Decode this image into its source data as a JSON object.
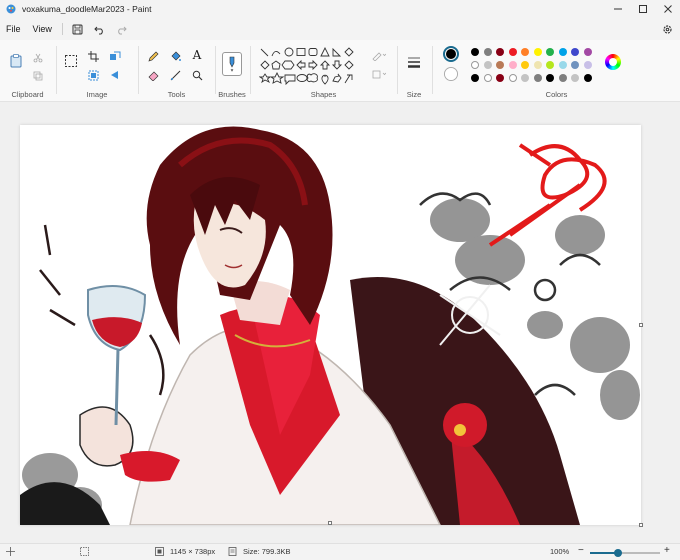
{
  "window": {
    "title": "voxakuma_doodleMar2023 - Paint"
  },
  "menu": {
    "file": "File",
    "view": "View"
  },
  "ribbon": {
    "groups": {
      "clipboard": "Clipboard",
      "image": "Image",
      "tools": "Tools",
      "brushes": "Brushes",
      "shapes": "Shapes",
      "size": "Size",
      "colors": "Colors"
    },
    "text_tool_glyph": "A",
    "primary_color": "#000000",
    "secondary_color": "#ffffff",
    "palette_row1": [
      "#000000",
      "#7f7f7f",
      "#880015",
      "#ed1c24",
      "#ff7f27",
      "#fff200",
      "#22b14c",
      "#00a2e8",
      "#3f48cc",
      "#a349a4"
    ],
    "palette_row2": [
      "#ffffff",
      "#c3c3c3",
      "#b97a57",
      "#ffaec9",
      "#ffc90e",
      "#efe4b0",
      "#b5e61d",
      "#99d9ea",
      "#7092be",
      "#c8bfe7"
    ],
    "palette_row3": [
      "#000000",
      "#ffffff",
      "#880015",
      "#ffffff",
      "#c3c3c3",
      "#7f7f7f",
      "#000000",
      "#7f7f7f",
      "#c3c3c3",
      "#000000"
    ]
  },
  "status": {
    "dimensions": "1145 × 738px",
    "size": "Size: 799.3KB",
    "zoom": "100%",
    "zoom_level": 0.4
  }
}
